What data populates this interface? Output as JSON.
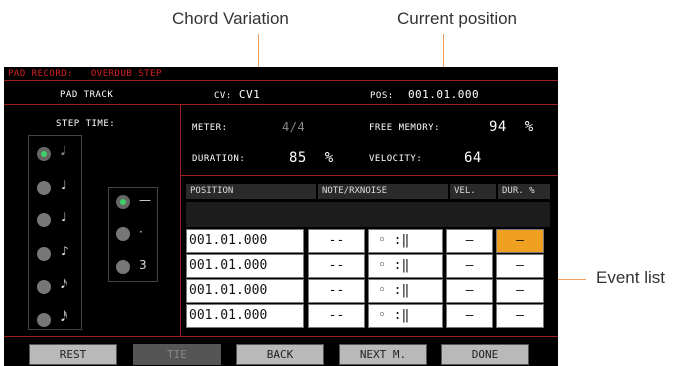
{
  "callouts": {
    "chord_variation": "Chord Variation",
    "current_position": "Current position",
    "event_list": "Event list"
  },
  "header": {
    "title": "PAD RECORD:",
    "mode": "OVERDUB STEP",
    "track": "PAD TRACK",
    "cv_label": "CV:",
    "cv_value": "CV1",
    "pos_label": "POS:",
    "pos_value": "001.01.000"
  },
  "step_time": {
    "label": "STEP TIME:",
    "notes": [
      "𝅗𝅥",
      "♩",
      "♩",
      "♪",
      "𝅘𝅥𝅯",
      "𝅘𝅥𝅰"
    ],
    "selected_index": 0,
    "modifiers": [
      "—",
      "·",
      "3"
    ],
    "selected_modifier": 0
  },
  "info": {
    "meter_label": "METER:",
    "meter_value": "4/4",
    "free_memory_label": "FREE MEMORY:",
    "free_memory_value": "94",
    "free_memory_unit": "%",
    "duration_label": "DURATION:",
    "duration_value": "85",
    "duration_unit": "%",
    "velocity_label": "VELOCITY:",
    "velocity_value": "64"
  },
  "event_table": {
    "columns": [
      "POSITION",
      "NOTE/RXNOISE",
      "VEL.",
      "DUR. %"
    ],
    "rows": [
      {
        "position": "001.01.000",
        "note": "--",
        "rx": "◦ :‖",
        "vel": "–",
        "dur": "–"
      },
      {
        "position": "001.01.000",
        "note": "--",
        "rx": "◦ :‖",
        "vel": "–",
        "dur": "–"
      },
      {
        "position": "001.01.000",
        "note": "--",
        "rx": "◦ :‖",
        "vel": "–",
        "dur": "–"
      },
      {
        "position": "001.01.000",
        "note": "--",
        "rx": "◦ :‖",
        "vel": "–",
        "dur": "–"
      }
    ]
  },
  "buttons": {
    "rest": "REST",
    "tie": "TIE",
    "back": "BACK",
    "next": "NEXT M.",
    "done": "DONE"
  },
  "colors": {
    "accent": "#f0a020",
    "title_red": "#d42020",
    "frame_red": "#9a2020",
    "led_green": "#3fd06a"
  }
}
